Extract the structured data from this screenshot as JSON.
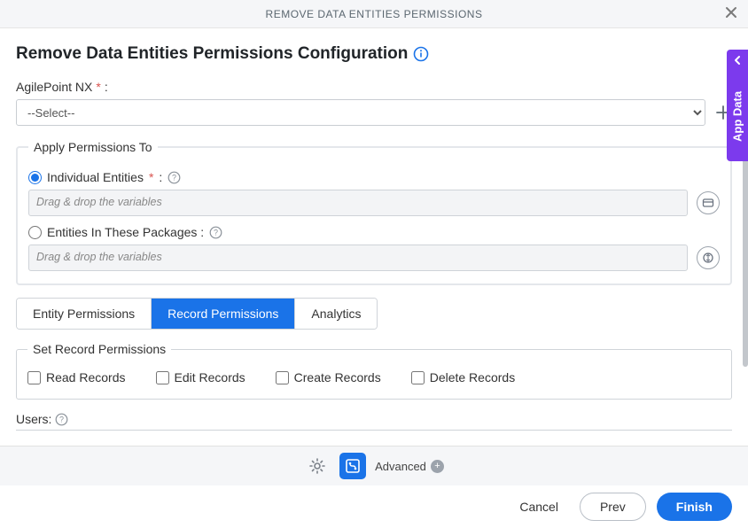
{
  "titlebar": {
    "title": "REMOVE DATA ENTITIES PERMISSIONS"
  },
  "heading": "Remove Data Entities Permissions Configuration",
  "agilepoint": {
    "label": "AgilePoint NX",
    "select_placeholder": "--Select--"
  },
  "apply_group": {
    "legend": "Apply Permissions To",
    "individual_label": "Individual Entities",
    "packages_label": "Entities In These Packages :",
    "drop_placeholder": "Drag & drop the variables"
  },
  "tabs": {
    "entity": "Entity Permissions",
    "record": "Record Permissions",
    "analytics": "Analytics"
  },
  "record_perms": {
    "legend": "Set Record Permissions",
    "read": "Read Records",
    "edit": "Edit Records",
    "create": "Create Records",
    "delete": "Delete Records"
  },
  "users_label": "Users:",
  "footer": {
    "advanced": "Advanced",
    "cancel": "Cancel",
    "prev": "Prev",
    "finish": "Finish"
  },
  "sidebar": {
    "label": "App Data"
  }
}
